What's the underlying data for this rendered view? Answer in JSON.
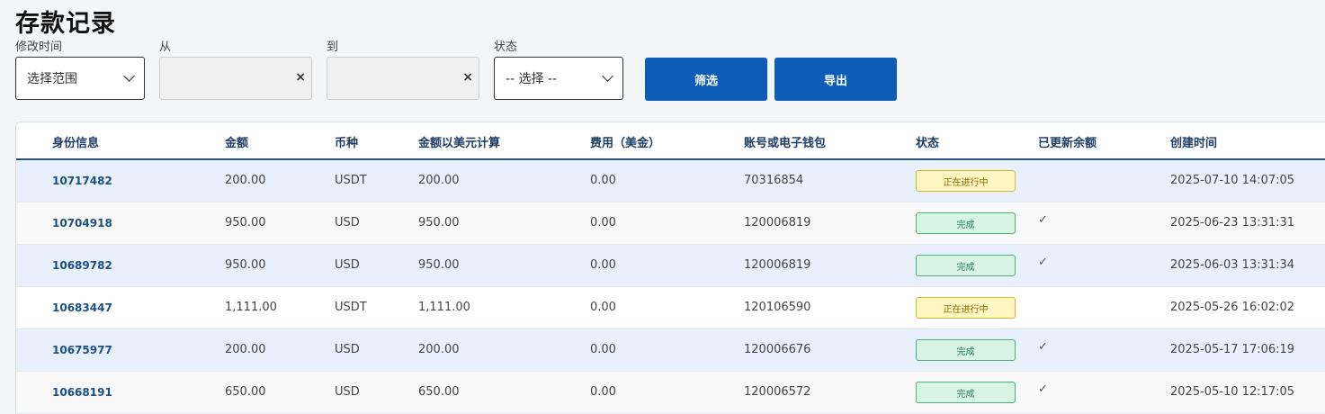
{
  "page": {
    "title": "存款记录"
  },
  "filters": {
    "time_label": "修改时间",
    "time_value": "选择范围",
    "from_label": "从",
    "to_label": "到",
    "status_label": "状态",
    "status_value": "-- 选择 --",
    "clear_symbol": "×",
    "filter_button": "筛选",
    "export_button": "导出"
  },
  "table": {
    "headers": [
      "身份信息",
      "金额",
      "币种",
      "金额以美元计算",
      "费用（美金）",
      "账号或电子钱包",
      "状态",
      "已更新余额",
      "创建时间"
    ],
    "rows": [
      {
        "id": "10717482",
        "amount": "200.00",
        "currency": "USDT",
        "usd": "200.00",
        "fee": "0.00",
        "account": "70316854",
        "status": "正在进行中",
        "updated": "",
        "created": "2025-07-10 14:07:05"
      },
      {
        "id": "10704918",
        "amount": "950.00",
        "currency": "USD",
        "usd": "950.00",
        "fee": "0.00",
        "account": "120006819",
        "status": "完成",
        "updated": "✓",
        "created": "2025-06-23 13:31:31"
      },
      {
        "id": "10689782",
        "amount": "950.00",
        "currency": "USD",
        "usd": "950.00",
        "fee": "0.00",
        "account": "120006819",
        "status": "完成",
        "updated": "✓",
        "created": "2025-06-03 13:31:34"
      },
      {
        "id": "10683447",
        "amount": "1,111.00",
        "currency": "USDT",
        "usd": "1,111.00",
        "fee": "0.00",
        "account": "120106590",
        "status": "正在进行中",
        "updated": "",
        "created": "2025-05-26 16:02:02"
      },
      {
        "id": "10675977",
        "amount": "200.00",
        "currency": "USD",
        "usd": "200.00",
        "fee": "0.00",
        "account": "120006676",
        "status": "完成",
        "updated": "✓",
        "created": "2025-05-17 17:06:19"
      },
      {
        "id": "10668191",
        "amount": "650.00",
        "currency": "USD",
        "usd": "650.00",
        "fee": "0.00",
        "account": "120006572",
        "status": "完成",
        "updated": "✓",
        "created": "2025-05-10 12:17:05"
      }
    ]
  },
  "colors": {
    "primary": "#0d5cb8",
    "pending_bg": "#fff6c2",
    "done_bg": "#d8f5e4",
    "row_alt": "#e8f0fc"
  }
}
